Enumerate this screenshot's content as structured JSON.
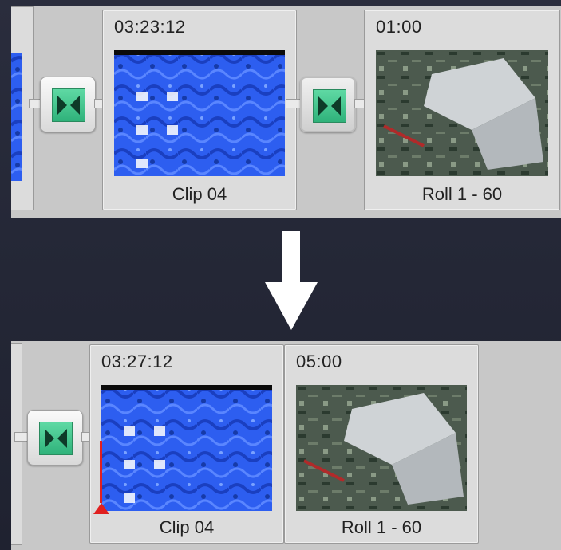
{
  "timeline_before": {
    "clip_a": {
      "duration": "03:23:12",
      "name": "Clip 04"
    },
    "clip_b": {
      "duration": "01:00",
      "name": "Roll 1 - 60"
    }
  },
  "timeline_after": {
    "clip_a": {
      "duration": "03:27:12",
      "name": "Clip 04"
    },
    "clip_b": {
      "duration": "05:00",
      "name": "Roll 1 - 60"
    }
  },
  "colors": {
    "transition_green": "#3cc58a",
    "strip_gray": "#c8c8c8",
    "background": "#252837"
  },
  "icons": [
    "transition-icon",
    "down-arrow-icon",
    "playhead-marker-icon"
  ]
}
